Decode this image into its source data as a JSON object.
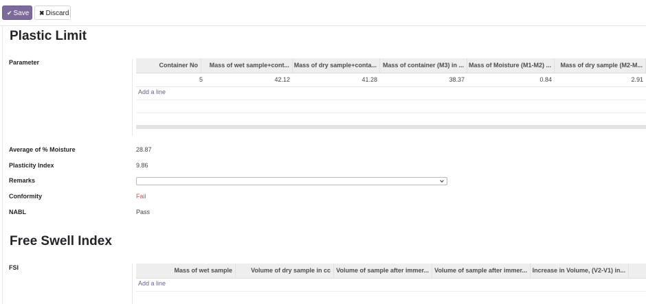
{
  "toolbar": {
    "save_label": "Save",
    "discard_label": "Discard"
  },
  "plastic_limit": {
    "title": "Plastic Limit",
    "parameter_label": "Parameter",
    "columns": [
      "Container No",
      "Mass of wet sample+cont...",
      "Mass of dry sample+conta...",
      "Mass of container (M3) in ...",
      "Mass of Moisture (M1-M2) ...",
      "Mass of dry sample (M2-M..."
    ],
    "rows": [
      [
        "5",
        "42.12",
        "41.28",
        "38.37",
        "0.84",
        "2.91"
      ]
    ],
    "add_line": "Add a line",
    "fields": {
      "avg_moisture_label": "Average of % Moisture",
      "avg_moisture_value": "28.87",
      "plasticity_label": "Plasticity Index",
      "plasticity_value": "9.86",
      "remarks_label": "Remarks",
      "remarks_value": "",
      "conformity_label": "Conformity",
      "conformity_value": "Fail",
      "nabl_label": "NABL",
      "nabl_value": "Pass"
    }
  },
  "free_swell": {
    "title": "Free Swell Index",
    "fsi_label": "FSI",
    "columns": [
      "Mass of wet sample",
      "Volume of dry sample in cc",
      "Volume of sample after immer...",
      "Volume of sample after immer...",
      "Increase in Volume, (V2-V1) in..."
    ],
    "add_line": "Add a line"
  },
  "colors": {
    "primary": "#7c6b9a",
    "fail": "#d9534f",
    "link": "#6f5e8c"
  },
  "icons": {
    "save": "check-icon",
    "discard": "close-icon",
    "select": "chevron-down-icon"
  }
}
